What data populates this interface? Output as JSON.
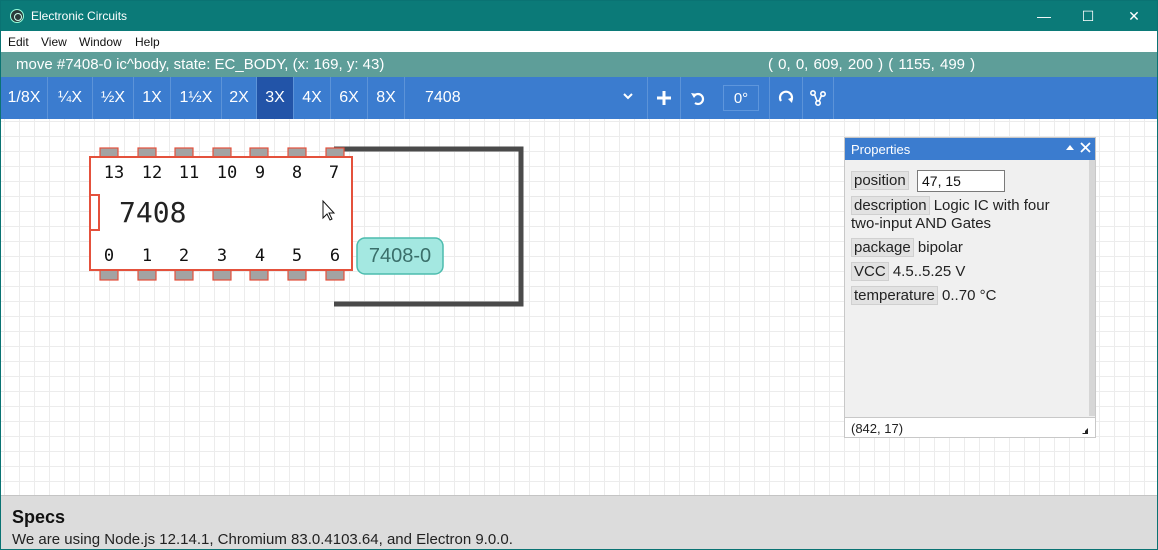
{
  "window": {
    "title": "Electronic Circuits",
    "minimize": "—",
    "maximize": "☐",
    "close": "✕"
  },
  "menu": [
    "Edit",
    "View",
    "Window",
    "Help"
  ],
  "status": {
    "message": "move #7408-0 ic^body, state: EC_BODY, (x: 169, y: 43)",
    "coords": "( 0, 0, 609, 200 )  ( 1155, 499 )"
  },
  "toolbar": {
    "zoom_levels": [
      "1/8X",
      "¼X",
      "½X",
      "1X",
      "1½X",
      "2X",
      "3X",
      "4X",
      "6X",
      "8X"
    ],
    "active_zoom": "3X",
    "component_name": "7408",
    "angle": "0°"
  },
  "chip": {
    "name": "7408",
    "label": "7408-0",
    "top_pins": [
      "13",
      "12",
      "11",
      "10",
      "9",
      "8",
      "7"
    ],
    "bottom_pins": [
      "0",
      "1",
      "2",
      "3",
      "4",
      "5",
      "6"
    ],
    "body_color": "#e4513c",
    "pin_color": "#a3a3a3",
    "label_bg": "#a4e8e1",
    "wire_color": "#4a4a4a"
  },
  "properties": {
    "title": "Properties",
    "position_label": "position",
    "position_value": "47, 15",
    "description_label": "description",
    "description_value_line1": "Logic IC with four",
    "description_value_line2": "two-input AND Gates",
    "package_label": "package",
    "package_value": "bipolar",
    "vcc_label": "VCC",
    "vcc_value": "4.5..5.25 V",
    "temperature_label": "temperature",
    "temperature_value": "0..70 °C",
    "footer": "(842, 17)"
  },
  "specs": {
    "title": "Specs",
    "text": "We are using Node.js 12.14.1, Chromium 83.0.4103.64, and Electron 9.0.0."
  },
  "colors": {
    "titlebar": "#0b7a78",
    "statusbar": "#5e9e99",
    "toolbar": "#3b7ccf",
    "toolbar_active": "#2254a8"
  }
}
